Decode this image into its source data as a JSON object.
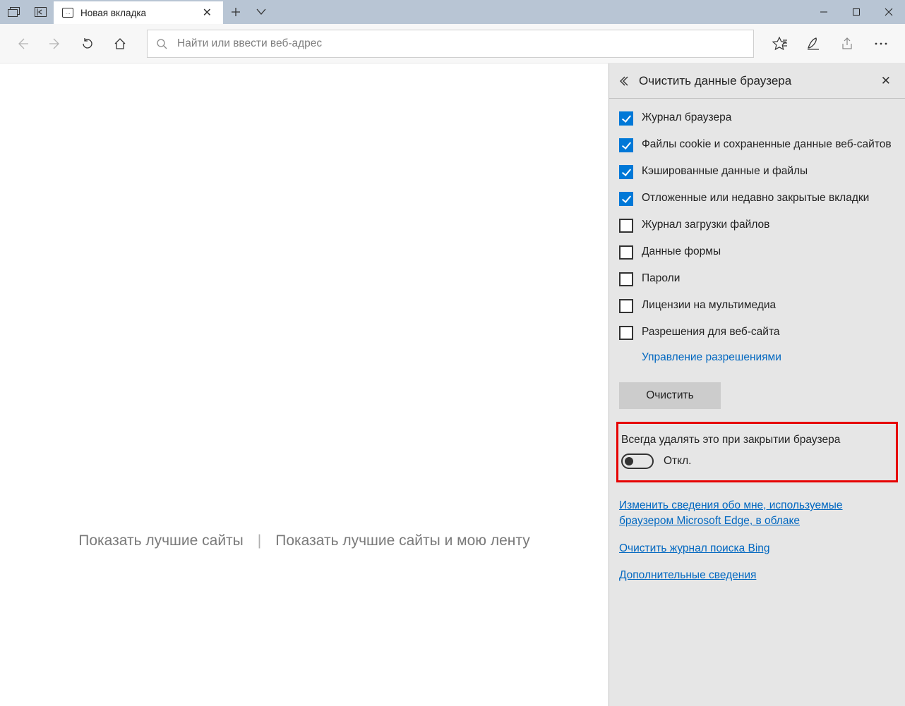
{
  "tab": {
    "title": "Новая вкладка"
  },
  "address_bar": {
    "placeholder": "Найти или ввести веб-адрес"
  },
  "start_page": {
    "option_a": "Показать лучшие сайты",
    "option_b": "Показать лучшие сайты и мою ленту"
  },
  "panel": {
    "title": "Очистить данные браузера",
    "checkboxes": [
      {
        "label": "Журнал браузера",
        "checked": true
      },
      {
        "label": "Файлы cookie и сохраненные данные веб-сайтов",
        "checked": true
      },
      {
        "label": "Кэшированные данные и файлы",
        "checked": true
      },
      {
        "label": "Отложенные или недавно закрытые вкладки",
        "checked": true
      },
      {
        "label": "Журнал загрузки файлов",
        "checked": false
      },
      {
        "label": "Данные формы",
        "checked": false
      },
      {
        "label": "Пароли",
        "checked": false
      },
      {
        "label": "Лицензии на мультимедиа",
        "checked": false
      },
      {
        "label": "Разрешения для веб-сайта",
        "checked": false
      }
    ],
    "manage_permissions": "Управление разрешениями",
    "clear_button": "Очистить",
    "always_clear": {
      "label": "Всегда удалять это при закрытии браузера",
      "state": "Откл."
    },
    "links": {
      "cloud_info": "Изменить сведения обо мне, используемые браузером Microsoft Edge, в облаке",
      "bing_history": "Очистить журнал поиска Bing",
      "more_info": "Дополнительные сведения"
    }
  }
}
